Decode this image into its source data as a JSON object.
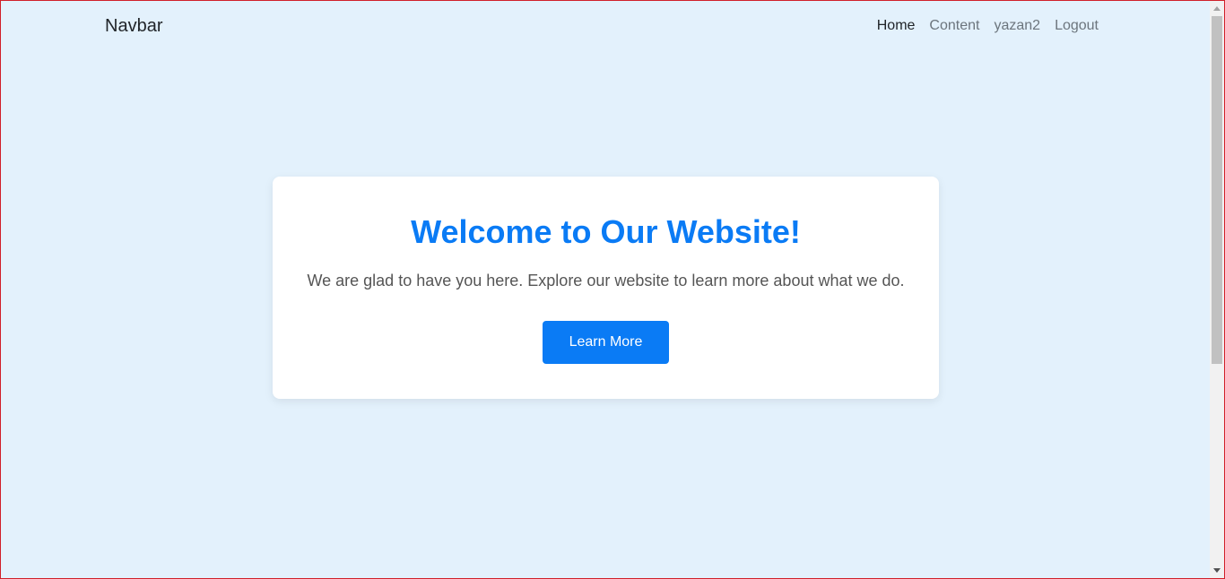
{
  "navbar": {
    "brand": "Navbar",
    "links": [
      {
        "label": "Home",
        "active": true
      },
      {
        "label": "Content",
        "active": false
      },
      {
        "label": "yazan2",
        "active": false
      },
      {
        "label": "Logout",
        "active": false
      }
    ]
  },
  "hero": {
    "title": "Welcome to Our Website!",
    "text": "We are glad to have you here. Explore our website to learn more about what we do.",
    "button_label": "Learn More"
  },
  "colors": {
    "background": "#e3f1fc",
    "accent": "#0a7bf5",
    "card": "#ffffff"
  }
}
